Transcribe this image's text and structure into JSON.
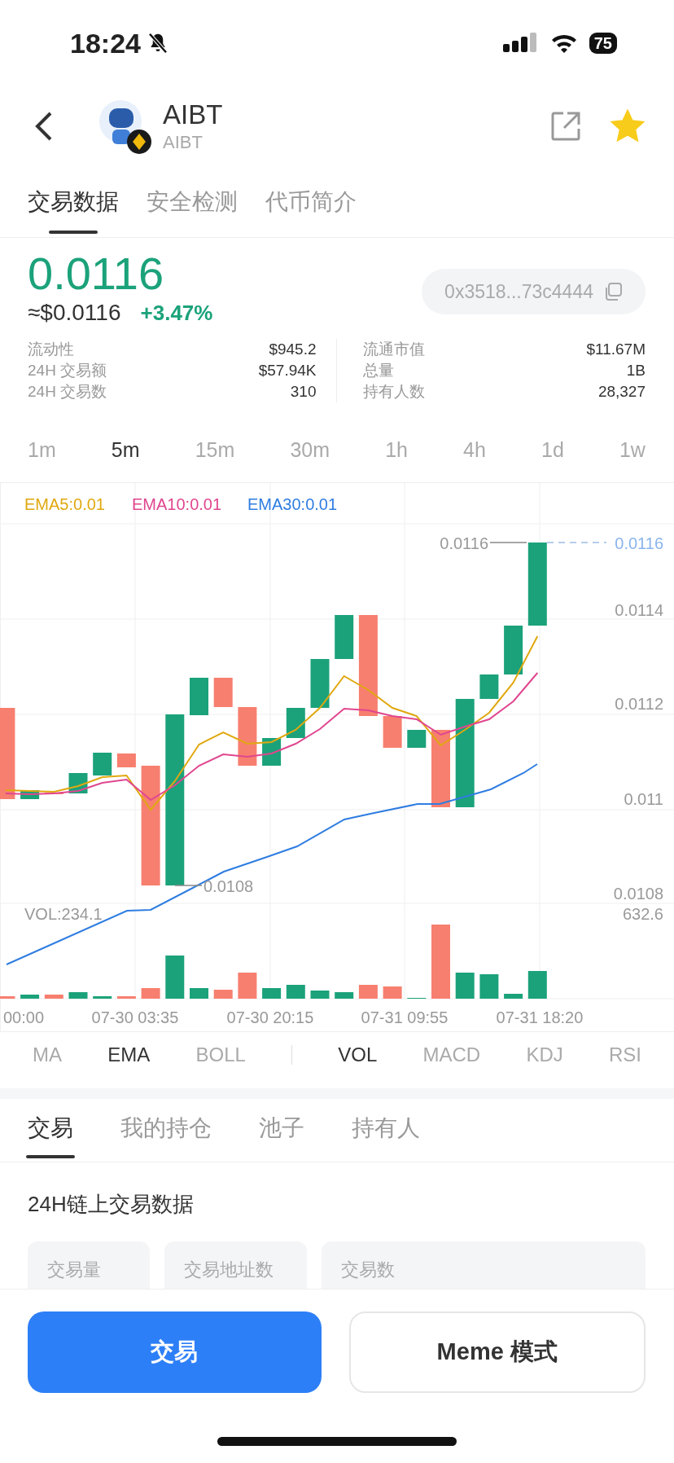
{
  "status_bar": {
    "time": "18:24",
    "battery": "75"
  },
  "header": {
    "title": "AIBT",
    "subtitle": "AIBT",
    "favorite": true
  },
  "top_tabs": [
    {
      "label": "交易数据",
      "selected": true
    },
    {
      "label": "安全检测",
      "selected": false
    },
    {
      "label": "代币简介",
      "selected": false
    }
  ],
  "price": {
    "value": "0.0116",
    "usd": "≈$0.0116",
    "change": "+3.47%",
    "address": "0x3518...73c4444"
  },
  "stats_left": [
    {
      "label": "流动性",
      "value": "$945.2"
    },
    {
      "label": "24H 交易额",
      "value": "$57.94K"
    },
    {
      "label": "24H 交易数",
      "value": "310"
    }
  ],
  "stats_right": [
    {
      "label": "流通市值",
      "value": "$11.67M"
    },
    {
      "label": "总量",
      "value": "1B"
    },
    {
      "label": "持有人数",
      "value": "28,327"
    }
  ],
  "timeframes": [
    {
      "label": "1m",
      "selected": false
    },
    {
      "label": "5m",
      "selected": true
    },
    {
      "label": "15m",
      "selected": false
    },
    {
      "label": "30m",
      "selected": false
    },
    {
      "label": "1h",
      "selected": false
    },
    {
      "label": "4h",
      "selected": false
    },
    {
      "label": "1d",
      "selected": false
    },
    {
      "label": "1w",
      "selected": false
    }
  ],
  "chart": {
    "legend": [
      {
        "label": "EMA5:0.01",
        "color": "#e0a810"
      },
      {
        "label": "EMA10:0.01",
        "color": "#e0468f"
      },
      {
        "label": "EMA30:0.01",
        "color": "#2f7de1"
      }
    ],
    "price_labels": [
      "0.0114",
      "0.0112",
      "0.011",
      "0.0108"
    ],
    "current_price": "0.0116",
    "high_marker": "0.0116",
    "low_marker": "0.0108",
    "volume_label": "VOL:234.1",
    "volume_max": "632.6",
    "time_labels": [
      "00:00",
      "07-30 03:35",
      "07-30 20:15",
      "07-31 09:55",
      "07-31 18:20"
    ]
  },
  "indicators": [
    {
      "label": "MA",
      "selected": false
    },
    {
      "label": "EMA",
      "selected": true
    },
    {
      "label": "BOLL",
      "selected": false
    },
    {
      "label": "VOL",
      "selected": true
    },
    {
      "label": "MACD",
      "selected": false
    },
    {
      "label": "KDJ",
      "selected": false
    },
    {
      "label": "RSI",
      "selected": false
    }
  ],
  "sub_tabs": [
    {
      "label": "交易",
      "selected": true
    },
    {
      "label": "我的持仓",
      "selected": false
    },
    {
      "label": "池子",
      "selected": false
    },
    {
      "label": "持有人",
      "selected": false
    }
  ],
  "section_title": "24H链上交易数据",
  "cards": [
    {
      "label": "交易量"
    },
    {
      "label": "交易地址数"
    },
    {
      "label": "交易数"
    }
  ],
  "buttons": [
    {
      "label": "交易",
      "kind": "primary"
    },
    {
      "label": "Meme 模式",
      "kind": "secondary"
    }
  ]
}
